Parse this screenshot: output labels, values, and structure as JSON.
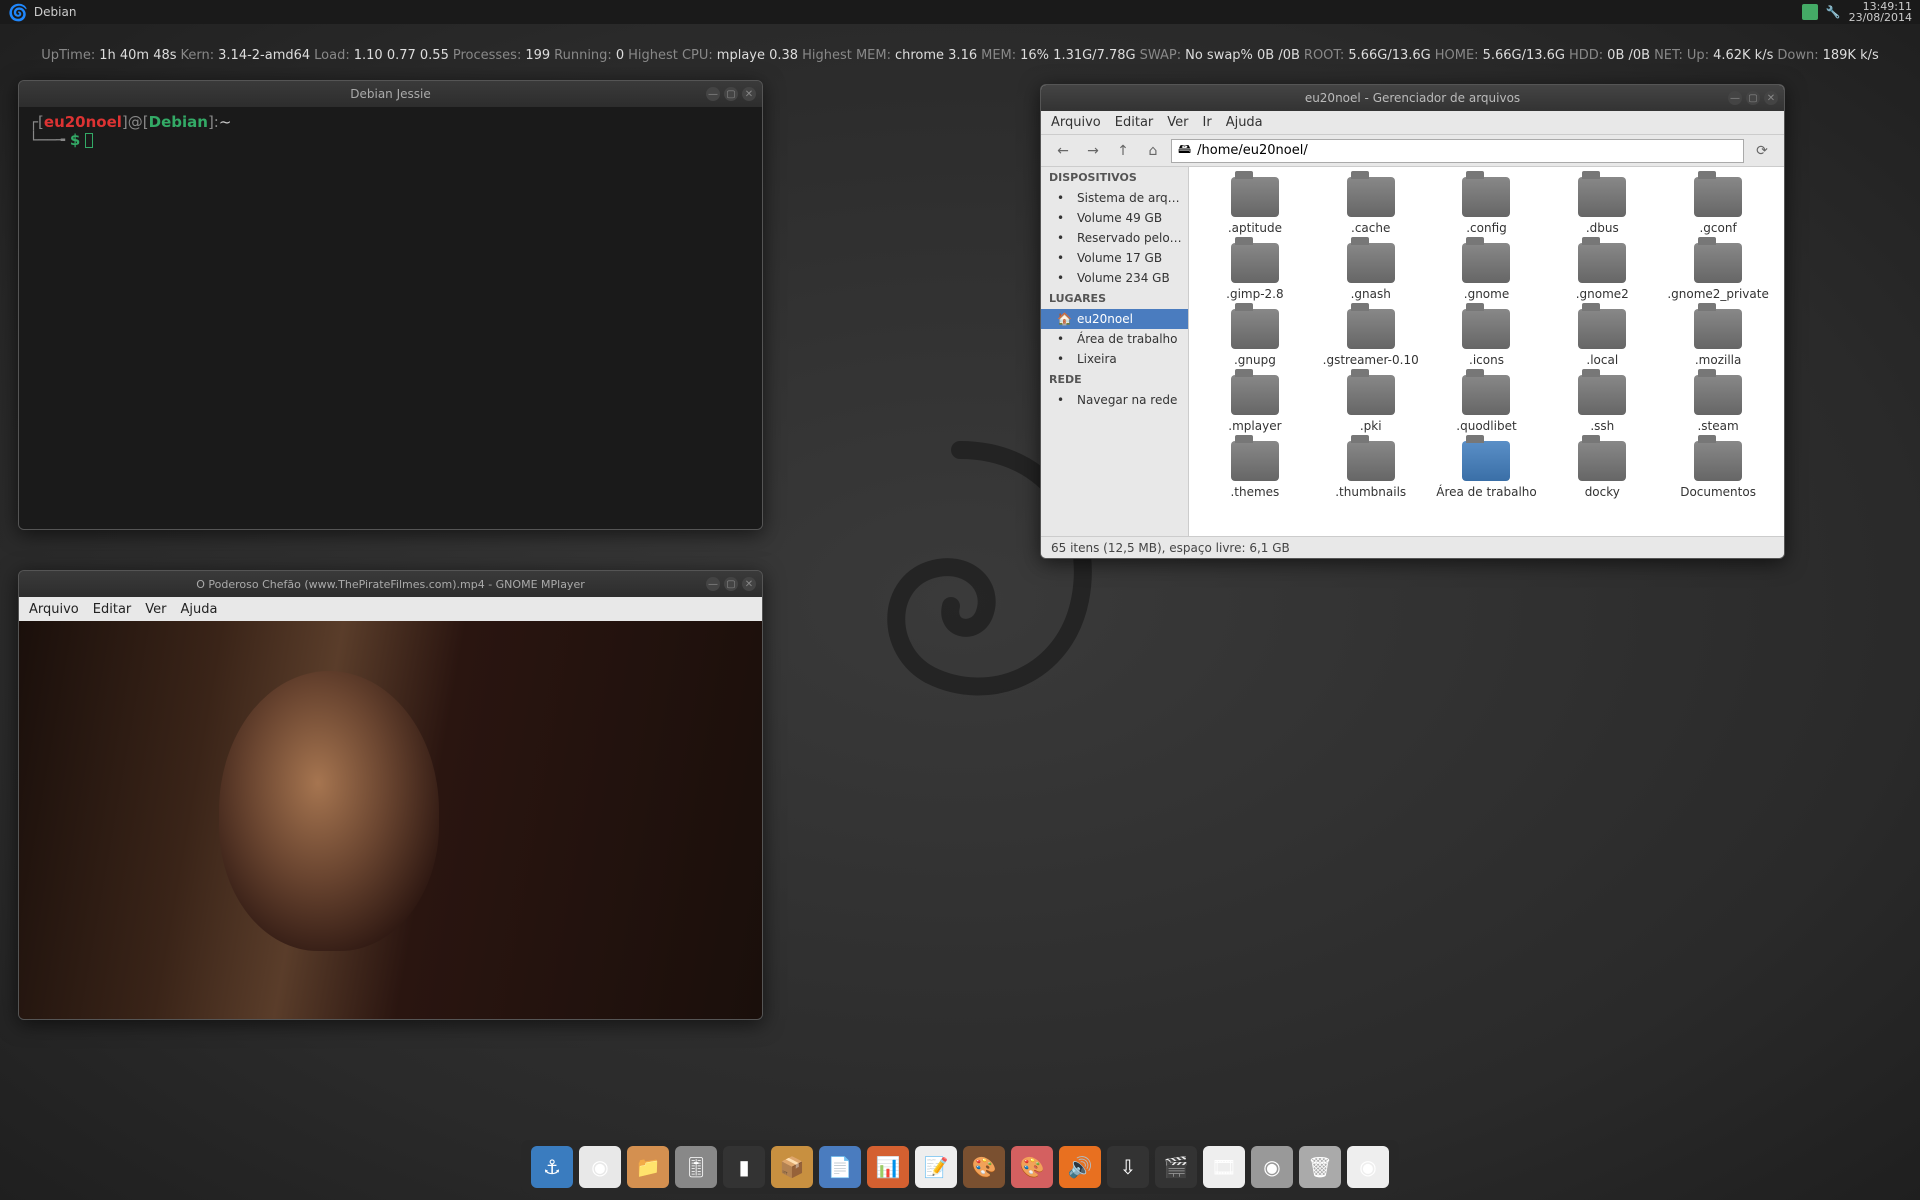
{
  "panel": {
    "distro": "Debian",
    "time": "13:49:11",
    "date": "23/08/2014"
  },
  "sysinfo": {
    "uptime_label": "UpTime:",
    "uptime": "1h 40m 48s",
    "kern_label": "Kern:",
    "kern": "3.14-2-amd64",
    "load_label": "Load:",
    "load": "1.10 0.77 0.55",
    "proc_label": "Processes:",
    "proc": "199",
    "run_label": "Running:",
    "run": "0",
    "hcpu_label": "Highest CPU:",
    "hcpu": "mplaye  0.38",
    "hmem_label": "Highest MEM:",
    "hmem": "chrome  3.16",
    "mem_label": "MEM:",
    "mem": "16% 1.31G/7.78G",
    "swap_label": "SWAP:",
    "swap": "No swap% 0B  /0B",
    "root_label": "ROOT:",
    "root": "5.66G/13.6G",
    "home_label": "HOME:",
    "home": "5.66G/13.6G",
    "hdd_label": "HDD:",
    "hdd": "0B  /0B",
    "net_label": "NET:",
    "net_up_label": "Up:",
    "net_up": "4.62K k/s",
    "net_down_label": "Down:",
    "net_down": "189K k/s"
  },
  "terminal": {
    "title": "Debian Jessie",
    "user": "eu20noel",
    "host": "Debian",
    "path": "~",
    "ps2": "$"
  },
  "mplayer": {
    "title": "O Poderoso Chefão (www.ThePirateFilmes.com).mp4 - GNOME MPlayer",
    "menu": [
      "Arquivo",
      "Editar",
      "Ver",
      "Ajuda"
    ]
  },
  "fm": {
    "title": "eu20noel - Gerenciador de arquivos",
    "menu": [
      "Arquivo",
      "Editar",
      "Ver",
      "Ir",
      "Ajuda"
    ],
    "path": "/home/eu20noel/",
    "sidebar": {
      "devices_label": "DISPOSITIVOS",
      "devices": [
        "Sistema de arq…",
        "Volume 49 GB",
        "Reservado pelo…",
        "Volume 17 GB",
        "Volume 234 GB"
      ],
      "places_label": "LUGARES",
      "places": [
        "eu20noel",
        "Área de trabalho",
        "Lixeira"
      ],
      "network_label": "REDE",
      "network": [
        "Navegar na rede"
      ]
    },
    "folders": [
      ".aptitude",
      ".cache",
      ".config",
      ".dbus",
      ".gconf",
      ".gimp-2.8",
      ".gnash",
      ".gnome",
      ".gnome2",
      ".gnome2_private",
      ".gnupg",
      ".gstreamer-0.10",
      ".icons",
      ".local",
      ".mozilla",
      ".mplayer",
      ".pki",
      ".quodlibet",
      ".ssh",
      ".steam",
      ".themes",
      ".thumbnails",
      "Área de trabalho",
      "docky",
      "Documentos"
    ],
    "special_folders": [
      "Área de trabalho"
    ],
    "status": "65 itens (12,5 MB), espaço livre: 6,1 GB"
  },
  "dock": [
    {
      "name": "anchor",
      "color": "#3a7cbf",
      "glyph": "⚓"
    },
    {
      "name": "chrome",
      "color": "#e8e8e8",
      "glyph": "◉"
    },
    {
      "name": "files",
      "color": "#d49050",
      "glyph": "📁"
    },
    {
      "name": "mixer",
      "color": "#888",
      "glyph": "🎚"
    },
    {
      "name": "terminal",
      "color": "#333",
      "glyph": "▮"
    },
    {
      "name": "archive",
      "color": "#c89040",
      "glyph": "📦"
    },
    {
      "name": "writer",
      "color": "#4a7cbf",
      "glyph": "📄"
    },
    {
      "name": "impress",
      "color": "#d46030",
      "glyph": "📊"
    },
    {
      "name": "notes",
      "color": "#eee",
      "glyph": "📝"
    },
    {
      "name": "gimp",
      "color": "#7a5030",
      "glyph": "🎨"
    },
    {
      "name": "palette",
      "color": "#d46060",
      "glyph": "🎨"
    },
    {
      "name": "rhythmbox",
      "color": "#e87020",
      "glyph": "🔊"
    },
    {
      "name": "transmission",
      "color": "#333",
      "glyph": "⇩"
    },
    {
      "name": "video",
      "color": "#333",
      "glyph": "🎬"
    },
    {
      "name": "clip",
      "color": "#eee",
      "glyph": "🎞"
    },
    {
      "name": "steam",
      "color": "#999",
      "glyph": "◉"
    },
    {
      "name": "trash",
      "color": "#aaa",
      "glyph": "🗑"
    },
    {
      "name": "chromium",
      "color": "#eee",
      "glyph": "◉"
    }
  ]
}
